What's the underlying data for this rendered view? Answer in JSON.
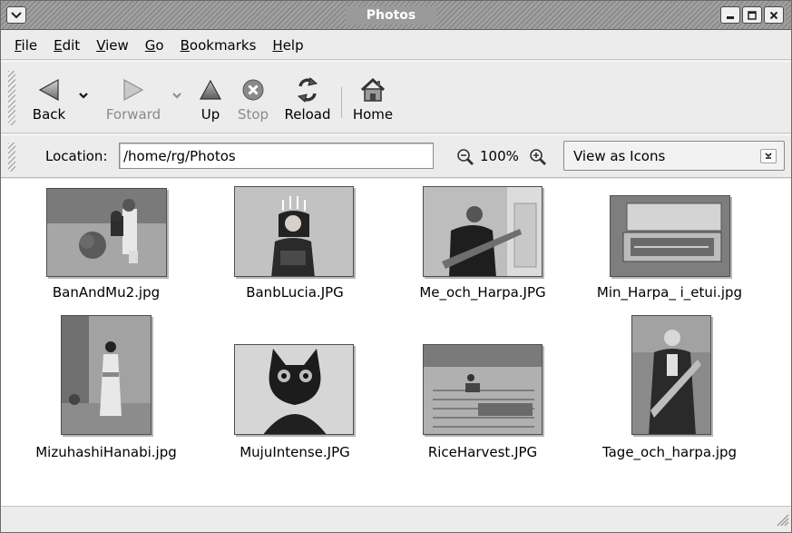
{
  "window": {
    "title": "Photos"
  },
  "menubar": {
    "items": [
      {
        "underline": "F",
        "rest": "ile"
      },
      {
        "underline": "E",
        "rest": "dit"
      },
      {
        "underline": "V",
        "rest": "iew"
      },
      {
        "underline": "G",
        "rest": "o"
      },
      {
        "underline": "B",
        "rest": "ookmarks"
      },
      {
        "underline": "H",
        "rest": "elp"
      }
    ]
  },
  "toolbar": {
    "back": "Back",
    "forward": "Forward",
    "up": "Up",
    "stop": "Stop",
    "reload": "Reload",
    "home": "Home"
  },
  "location": {
    "label": "Location:",
    "value": "/home/rg/Photos",
    "zoom": "100%",
    "view_mode": "View as Icons"
  },
  "files": [
    {
      "name": "BanAndMu2.jpg"
    },
    {
      "name": "BanbLucia.JPG"
    },
    {
      "name": "Me_och_Harpa.JPG"
    },
    {
      "name": "Min_Harpa_ i_etui.jpg"
    },
    {
      "name": "MizuhashiHanabi.jpg"
    },
    {
      "name": "MujuIntense.JPG"
    },
    {
      "name": "RiceHarvest.JPG"
    },
    {
      "name": "Tage_och_harpa.jpg"
    }
  ],
  "colors": {
    "titlebar": "#9a9a9a",
    "window_bg": "#ececec",
    "content_bg": "#ffffff"
  }
}
